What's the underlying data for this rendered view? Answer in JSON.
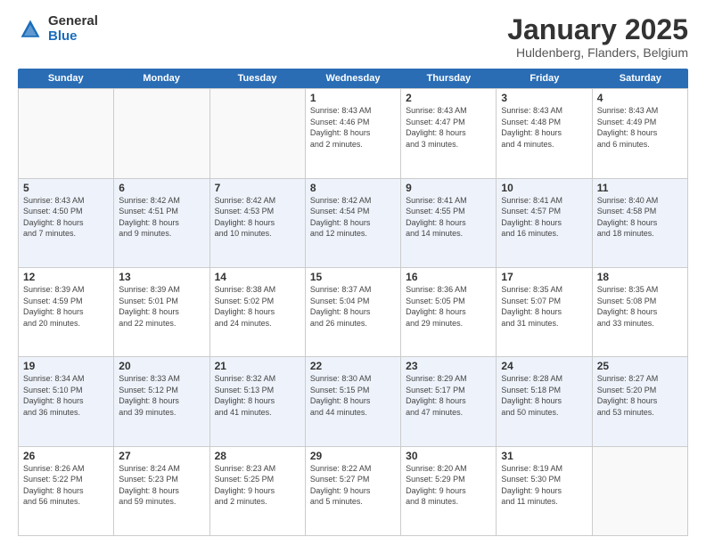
{
  "logo": {
    "general": "General",
    "blue": "Blue"
  },
  "title": "January 2025",
  "location": "Huldenberg, Flanders, Belgium",
  "weekdays": [
    "Sunday",
    "Monday",
    "Tuesday",
    "Wednesday",
    "Thursday",
    "Friday",
    "Saturday"
  ],
  "weeks": [
    [
      {
        "day": "",
        "info": ""
      },
      {
        "day": "",
        "info": ""
      },
      {
        "day": "",
        "info": ""
      },
      {
        "day": "1",
        "info": "Sunrise: 8:43 AM\nSunset: 4:46 PM\nDaylight: 8 hours\nand 2 minutes."
      },
      {
        "day": "2",
        "info": "Sunrise: 8:43 AM\nSunset: 4:47 PM\nDaylight: 8 hours\nand 3 minutes."
      },
      {
        "day": "3",
        "info": "Sunrise: 8:43 AM\nSunset: 4:48 PM\nDaylight: 8 hours\nand 4 minutes."
      },
      {
        "day": "4",
        "info": "Sunrise: 8:43 AM\nSunset: 4:49 PM\nDaylight: 8 hours\nand 6 minutes."
      }
    ],
    [
      {
        "day": "5",
        "info": "Sunrise: 8:43 AM\nSunset: 4:50 PM\nDaylight: 8 hours\nand 7 minutes."
      },
      {
        "day": "6",
        "info": "Sunrise: 8:42 AM\nSunset: 4:51 PM\nDaylight: 8 hours\nand 9 minutes."
      },
      {
        "day": "7",
        "info": "Sunrise: 8:42 AM\nSunset: 4:53 PM\nDaylight: 8 hours\nand 10 minutes."
      },
      {
        "day": "8",
        "info": "Sunrise: 8:42 AM\nSunset: 4:54 PM\nDaylight: 8 hours\nand 12 minutes."
      },
      {
        "day": "9",
        "info": "Sunrise: 8:41 AM\nSunset: 4:55 PM\nDaylight: 8 hours\nand 14 minutes."
      },
      {
        "day": "10",
        "info": "Sunrise: 8:41 AM\nSunset: 4:57 PM\nDaylight: 8 hours\nand 16 minutes."
      },
      {
        "day": "11",
        "info": "Sunrise: 8:40 AM\nSunset: 4:58 PM\nDaylight: 8 hours\nand 18 minutes."
      }
    ],
    [
      {
        "day": "12",
        "info": "Sunrise: 8:39 AM\nSunset: 4:59 PM\nDaylight: 8 hours\nand 20 minutes."
      },
      {
        "day": "13",
        "info": "Sunrise: 8:39 AM\nSunset: 5:01 PM\nDaylight: 8 hours\nand 22 minutes."
      },
      {
        "day": "14",
        "info": "Sunrise: 8:38 AM\nSunset: 5:02 PM\nDaylight: 8 hours\nand 24 minutes."
      },
      {
        "day": "15",
        "info": "Sunrise: 8:37 AM\nSunset: 5:04 PM\nDaylight: 8 hours\nand 26 minutes."
      },
      {
        "day": "16",
        "info": "Sunrise: 8:36 AM\nSunset: 5:05 PM\nDaylight: 8 hours\nand 29 minutes."
      },
      {
        "day": "17",
        "info": "Sunrise: 8:35 AM\nSunset: 5:07 PM\nDaylight: 8 hours\nand 31 minutes."
      },
      {
        "day": "18",
        "info": "Sunrise: 8:35 AM\nSunset: 5:08 PM\nDaylight: 8 hours\nand 33 minutes."
      }
    ],
    [
      {
        "day": "19",
        "info": "Sunrise: 8:34 AM\nSunset: 5:10 PM\nDaylight: 8 hours\nand 36 minutes."
      },
      {
        "day": "20",
        "info": "Sunrise: 8:33 AM\nSunset: 5:12 PM\nDaylight: 8 hours\nand 39 minutes."
      },
      {
        "day": "21",
        "info": "Sunrise: 8:32 AM\nSunset: 5:13 PM\nDaylight: 8 hours\nand 41 minutes."
      },
      {
        "day": "22",
        "info": "Sunrise: 8:30 AM\nSunset: 5:15 PM\nDaylight: 8 hours\nand 44 minutes."
      },
      {
        "day": "23",
        "info": "Sunrise: 8:29 AM\nSunset: 5:17 PM\nDaylight: 8 hours\nand 47 minutes."
      },
      {
        "day": "24",
        "info": "Sunrise: 8:28 AM\nSunset: 5:18 PM\nDaylight: 8 hours\nand 50 minutes."
      },
      {
        "day": "25",
        "info": "Sunrise: 8:27 AM\nSunset: 5:20 PM\nDaylight: 8 hours\nand 53 minutes."
      }
    ],
    [
      {
        "day": "26",
        "info": "Sunrise: 8:26 AM\nSunset: 5:22 PM\nDaylight: 8 hours\nand 56 minutes."
      },
      {
        "day": "27",
        "info": "Sunrise: 8:24 AM\nSunset: 5:23 PM\nDaylight: 8 hours\nand 59 minutes."
      },
      {
        "day": "28",
        "info": "Sunrise: 8:23 AM\nSunset: 5:25 PM\nDaylight: 9 hours\nand 2 minutes."
      },
      {
        "day": "29",
        "info": "Sunrise: 8:22 AM\nSunset: 5:27 PM\nDaylight: 9 hours\nand 5 minutes."
      },
      {
        "day": "30",
        "info": "Sunrise: 8:20 AM\nSunset: 5:29 PM\nDaylight: 9 hours\nand 8 minutes."
      },
      {
        "day": "31",
        "info": "Sunrise: 8:19 AM\nSunset: 5:30 PM\nDaylight: 9 hours\nand 11 minutes."
      },
      {
        "day": "",
        "info": ""
      }
    ]
  ]
}
